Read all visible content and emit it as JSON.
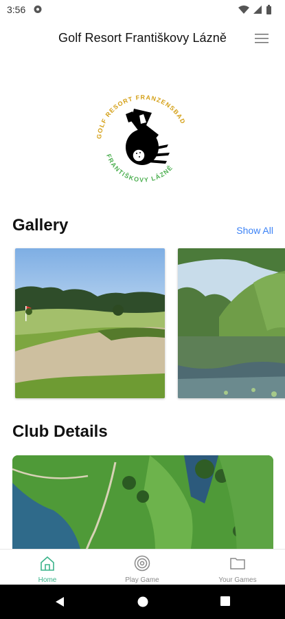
{
  "status_bar": {
    "time": "3:56"
  },
  "header": {
    "title": "Golf Resort Františkovy Lázně"
  },
  "logo": {
    "ring_text_top": "GOLF RESORT FRANZENSBAD",
    "ring_text_bottom": "FRANTIŠKOVY LÁZNĚ"
  },
  "gallery": {
    "title": "Gallery",
    "show_all_label": "Show All"
  },
  "club_details": {
    "title": "Club Details"
  },
  "bottom_nav": {
    "items": [
      {
        "label": "Home",
        "icon": "home-icon",
        "active": true
      },
      {
        "label": "Play Game",
        "icon": "target-icon",
        "active": false
      },
      {
        "label": "Your Games",
        "icon": "folder-icon",
        "active": false
      }
    ]
  },
  "colors": {
    "accent": "#3bb38a",
    "link": "#3b82f6"
  }
}
